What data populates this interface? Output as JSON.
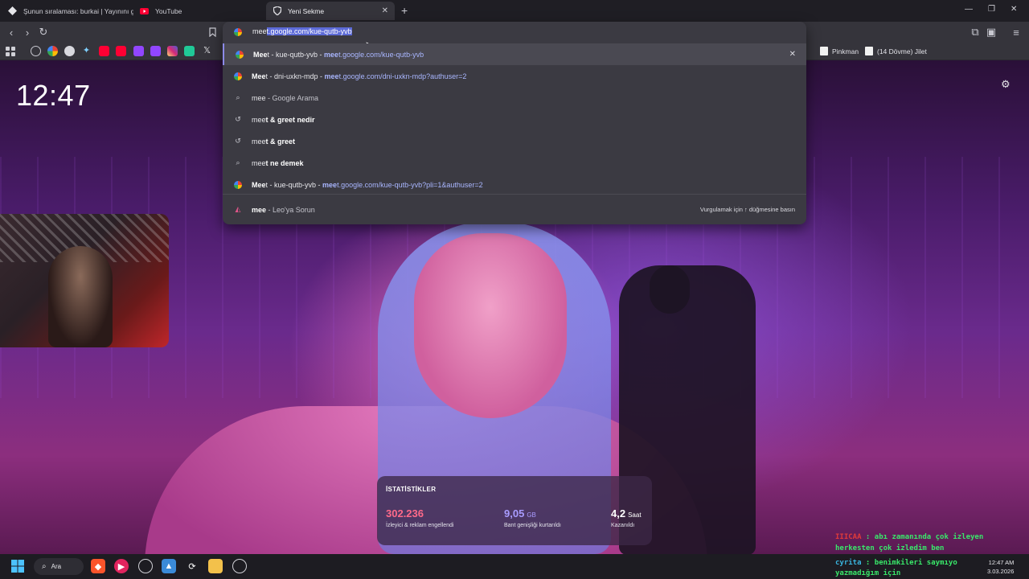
{
  "tabs": [
    {
      "title": "Şunun sıralaması: burkai | Yayınını gü",
      "active": false
    },
    {
      "title": "YouTube",
      "active": false
    },
    {
      "title": "Yeni Sekme",
      "active": true
    }
  ],
  "omnibox": {
    "typed": "mee",
    "autocomplete": "t.google.com/kue-qutb-yvb",
    "suggestions": [
      {
        "icon": "google-icon",
        "bold": "Mee",
        "rest": "t - kue-qutb-yvb - ",
        "url_bold": "mee",
        "url": "t.google.com/kue-qutb-yvb",
        "removable": true
      },
      {
        "icon": "google-icon",
        "bold": "Mee",
        "rest": "t - dni-uxkn-mdp - ",
        "url_bold": "mee",
        "url": "t.google.com/dni-uxkn-mdp?authuser=2"
      },
      {
        "icon": "search-icon",
        "bold": "",
        "rest": "mee",
        "suffix": " - Google Arama"
      },
      {
        "icon": "history-icon",
        "rest": "mee",
        "bold_after": "t & greet nedir"
      },
      {
        "icon": "history-icon",
        "rest": "mee",
        "bold_after": "t & greet"
      },
      {
        "icon": "search-icon",
        "rest": "mee",
        "bold_after": "t ne demek"
      },
      {
        "icon": "google-icon",
        "bold": "Mee",
        "rest": "t - kue-qutb-yvb - ",
        "url_bold": "mee",
        "url": "t.google.com/kue-qutb-yvb?pli=1&authuser=2"
      }
    ],
    "leo": {
      "query": "mee",
      "label": " - Leo'ya Sorun",
      "hint": "Vurgulamak için ↑ düğmesine basın"
    }
  },
  "bookmarks": {
    "text_items": [
      "Pinkman",
      "(14 Dövme) Jilet"
    ],
    "colors": [
      "#9aa0a6",
      "#4285f4",
      "#e6e6ea",
      "#c33",
      "#ff0000",
      "#ff0000",
      "#9146ff",
      "#9146ff",
      "#e1306c",
      "#20c997",
      "#e6e6ea"
    ]
  },
  "newtab": {
    "clock": "12:47",
    "stats": {
      "title": "İSTATİSTİKLER",
      "items": [
        {
          "value": "302.236",
          "unit": "",
          "label": "İzleyici & reklam engellendi",
          "color": "#ff6a8a"
        },
        {
          "value": "9,05",
          "unit": "GB",
          "label": "Bant genişliği kurtarıldı",
          "color": "#a99cff"
        },
        {
          "value": "4,2",
          "unit": "Saat",
          "label": "Kazanıldı",
          "color": "#ffffff"
        }
      ]
    }
  },
  "taskbar": {
    "search_label": "Ara",
    "time": "12:47 AM",
    "date": "3.03.2026"
  },
  "chat": [
    {
      "name": "IIICAA",
      "sep": " : ",
      "text": "abı zamanında çok izleyen"
    },
    {
      "name": "",
      "sep": "",
      "text": "herkesten çok izledim ben"
    },
    {
      "name": "cyrita",
      "sep": " : ",
      "text": "benimkileri saymıyo"
    },
    {
      "name": "",
      "sep": "",
      "text": "yazmadığım için"
    }
  ]
}
